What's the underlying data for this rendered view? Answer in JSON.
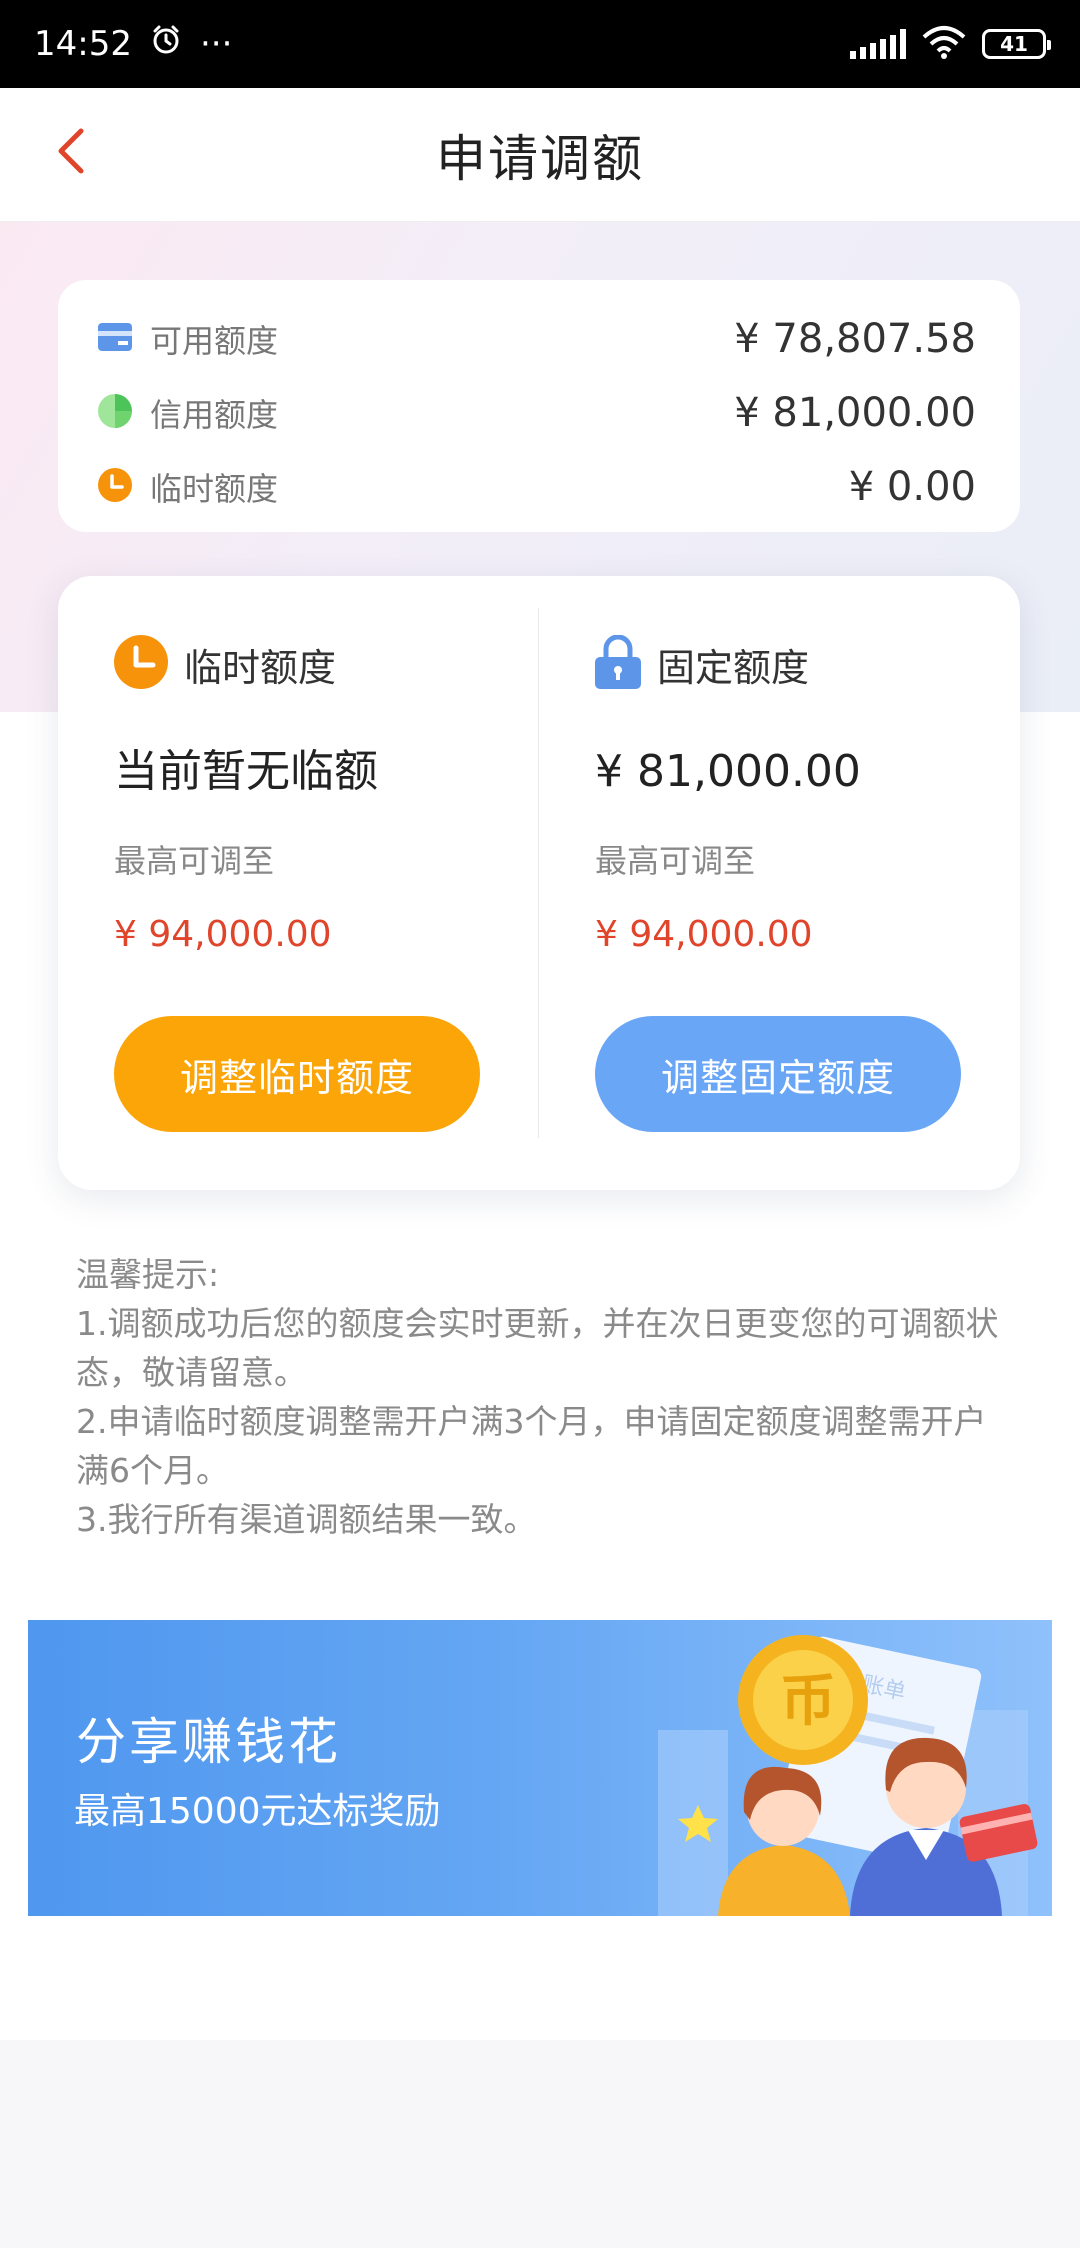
{
  "status_bar": {
    "time": "14:52",
    "more": "···",
    "battery": "41"
  },
  "nav": {
    "title": "申请调额"
  },
  "summary": {
    "rows": [
      {
        "label": "可用额度",
        "value": "¥ 78,807.58",
        "icon": "card-icon"
      },
      {
        "label": "信用额度",
        "value": "¥ 81,000.00",
        "icon": "pie-chart-icon"
      },
      {
        "label": "临时额度",
        "value": "¥ 0.00",
        "icon": "clock-icon"
      }
    ]
  },
  "quota": {
    "temporary": {
      "title": "临时额度",
      "current": "当前暂无临额",
      "max_label": "最高可调至",
      "max_value": "¥ 94,000.00",
      "button": "调整临时额度"
    },
    "fixed": {
      "title": "固定额度",
      "current": "¥ 81,000.00",
      "max_label": "最高可调至",
      "max_value": "¥ 94,000.00",
      "button": "调整固定额度"
    }
  },
  "tips": {
    "heading": "温馨提示:",
    "line1": "1.调额成功后您的额度会实时更新，并在次日更变您的可调额状态，敬请留意。",
    "line2": "2.申请临时额度调整需开户满3个月，申请固定额度调整需开户满6个月。",
    "line3": "3.我行所有渠道调额结果一致。"
  },
  "banner": {
    "title": "分享赚钱花",
    "subtitle": "最高15000元达标奖励",
    "coin_text": "币",
    "paper_text": "账单"
  },
  "colors": {
    "accent_red": "#e0452b",
    "orange": "#fca509",
    "blue": "#6aa6f6"
  }
}
